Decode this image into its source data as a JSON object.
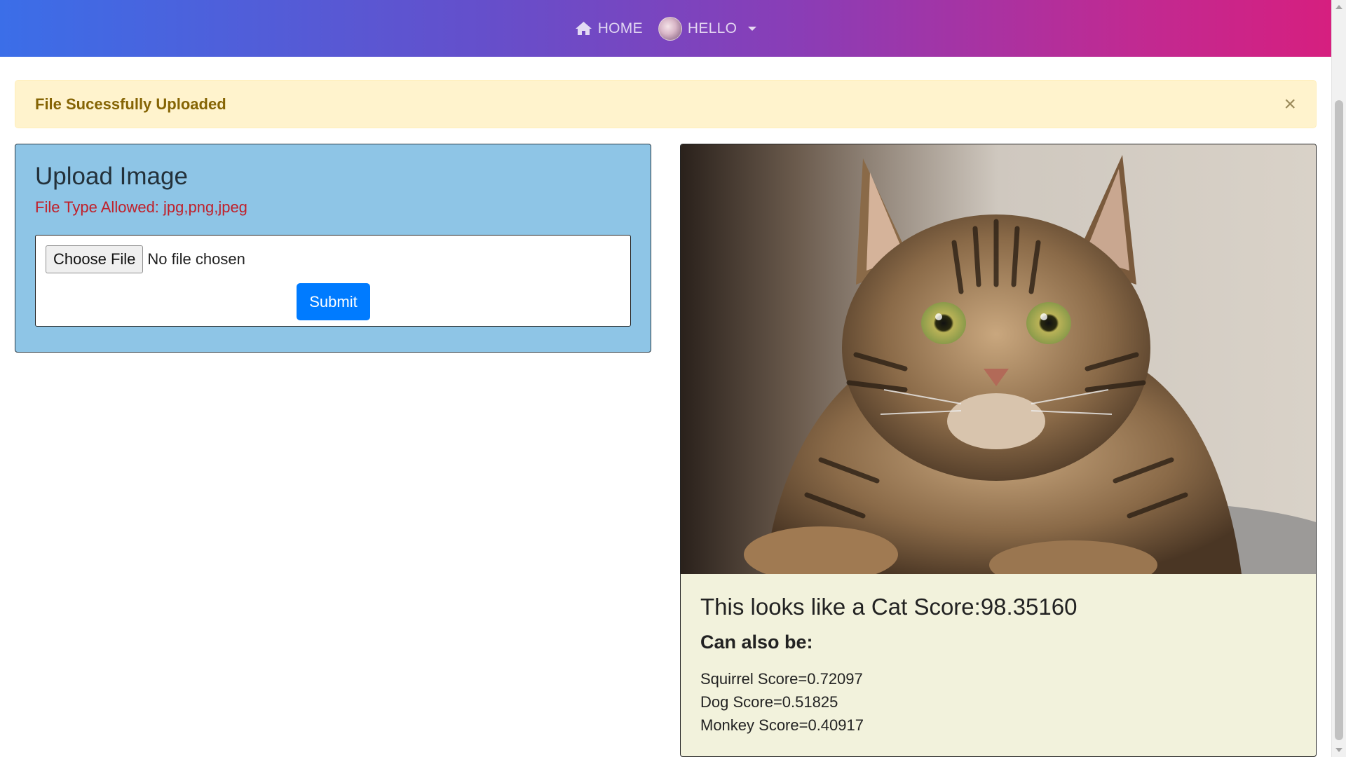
{
  "nav": {
    "home_label": "HOME",
    "user_label": "HELLO",
    "colors": {
      "gradient_start": "#3b6ee8",
      "gradient_end": "#d61f7f"
    }
  },
  "alert": {
    "message": "File Sucessfully Uploaded",
    "close_label": "×"
  },
  "upload": {
    "title": "Upload Image",
    "allowed_types": "File Type Allowed: jpg,png,jpeg",
    "choose_file_label": "Choose File",
    "file_status": "No file chosen",
    "submit_label": "Submit"
  },
  "result": {
    "image_subject": "tabby cat photo",
    "title": "This looks like a Cat Score:98.35160",
    "also_title": "Can also be:",
    "alternatives": [
      "Squirrel Score=0.72097",
      "Dog Score=0.51825",
      "Monkey Score=0.40917"
    ]
  }
}
